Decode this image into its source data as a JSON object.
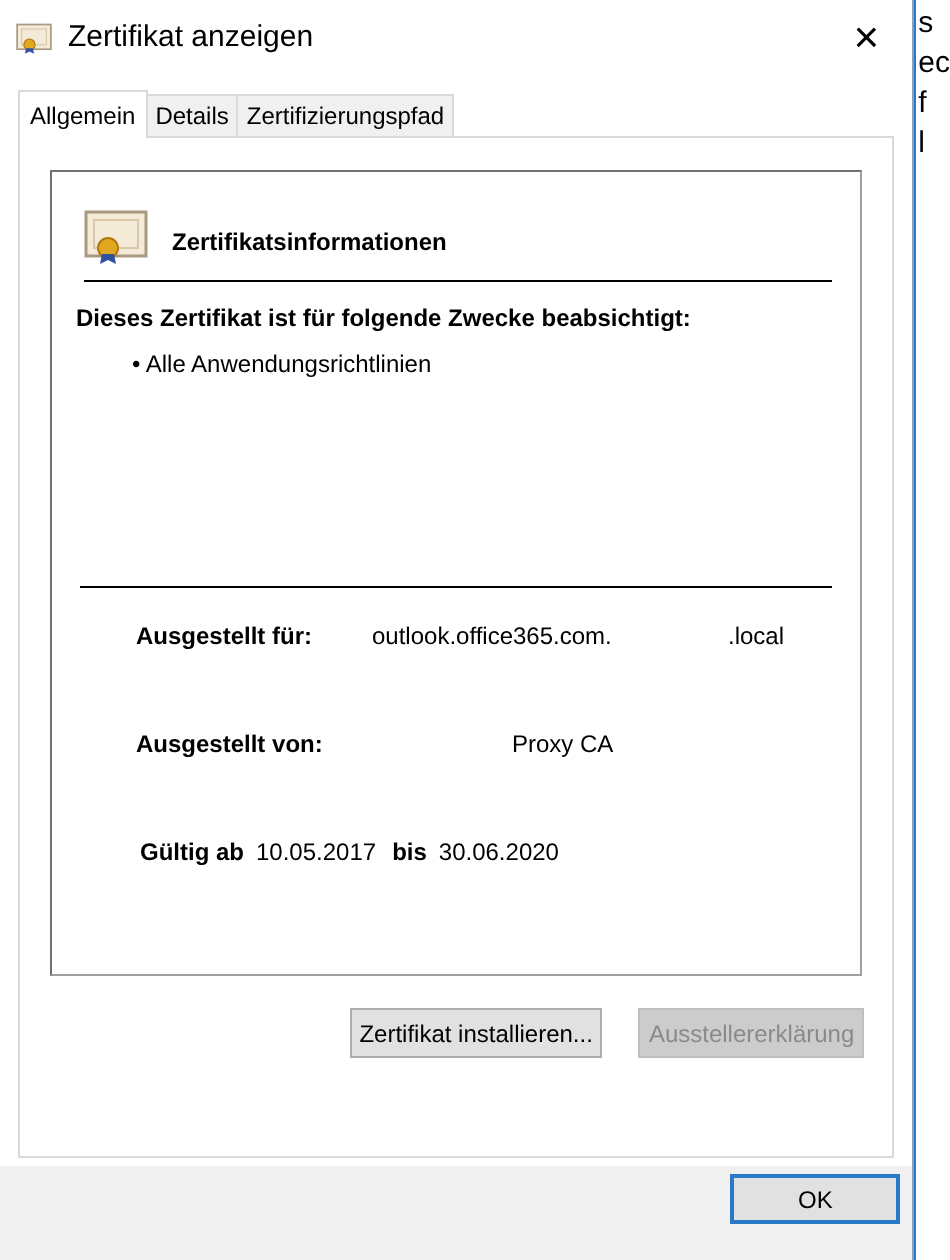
{
  "window": {
    "title": "Zertifikat anzeigen",
    "close": "×"
  },
  "tabs": [
    {
      "label": "Allgemein",
      "selected": true
    },
    {
      "label": "Details",
      "selected": false
    },
    {
      "label": "Zertifizierungspfad",
      "selected": false
    }
  ],
  "info": {
    "heading": "Zertifikatsinformationen",
    "purpose_title": "Dieses Zertifikat ist für folgende Zwecke beabsichtigt:",
    "purposes": [
      {
        "bullet": "•",
        "label": "Alle Anwendungsrichtlinien"
      }
    ],
    "issued_to_label": "Ausgestellt für:",
    "issued_to": [
      "outlook.office365.com.",
      ".local"
    ],
    "issued_by_label": "Ausgestellt von:",
    "issued_by": "Proxy CA",
    "valid_from_label": "Gültig ab",
    "valid_from": "10.05.2017",
    "valid_to_label": "bis",
    "valid_to": "30.06.2020"
  },
  "buttons": [
    {
      "label": "Zertifikat installieren...",
      "disabled": false
    },
    {
      "label": "Ausstellererklärung",
      "disabled": true
    }
  ],
  "ok_button": "OK",
  "background_window": {
    "lines": [
      "s",
      "ec",
      "f",
      "l"
    ]
  }
}
